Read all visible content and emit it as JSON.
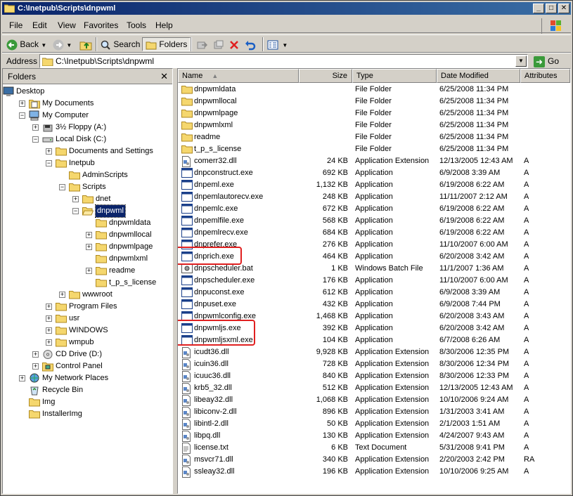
{
  "window": {
    "title": "C:\\Inetpub\\Scripts\\dnpwml"
  },
  "menu": [
    "File",
    "Edit",
    "View",
    "Favorites",
    "Tools",
    "Help"
  ],
  "toolbar": {
    "back": "Back",
    "search": "Search",
    "folders": "Folders"
  },
  "address": {
    "label": "Address",
    "value": "C:\\Inetpub\\Scripts\\dnpwml",
    "go": "Go"
  },
  "folders_pane": {
    "title": "Folders",
    "close": "✕"
  },
  "tree": [
    {
      "label": "Desktop",
      "level": 0,
      "exp": "",
      "icon": "desktop"
    },
    {
      "label": "My Documents",
      "level": 1,
      "exp": "+",
      "icon": "mydocs"
    },
    {
      "label": "My Computer",
      "level": 1,
      "exp": "-",
      "icon": "computer"
    },
    {
      "label": "3½ Floppy (A:)",
      "level": 2,
      "exp": "+",
      "icon": "floppy"
    },
    {
      "label": "Local Disk (C:)",
      "level": 2,
      "exp": "-",
      "icon": "disk"
    },
    {
      "label": "Documents and Settings",
      "level": 3,
      "exp": "+",
      "icon": "folder"
    },
    {
      "label": "Inetpub",
      "level": 3,
      "exp": "-",
      "icon": "folder"
    },
    {
      "label": "AdminScripts",
      "level": 4,
      "exp": "",
      "icon": "folder"
    },
    {
      "label": "Scripts",
      "level": 4,
      "exp": "-",
      "icon": "folder"
    },
    {
      "label": "dnet",
      "level": 5,
      "exp": "+",
      "icon": "folder"
    },
    {
      "label": "dnpwml",
      "level": 5,
      "exp": "-",
      "icon": "folderopen",
      "selected": true
    },
    {
      "label": "dnpwmldata",
      "level": 6,
      "exp": "",
      "icon": "folder"
    },
    {
      "label": "dnpwmllocal",
      "level": 6,
      "exp": "+",
      "icon": "folder"
    },
    {
      "label": "dnpwmlpage",
      "level": 6,
      "exp": "+",
      "icon": "folder"
    },
    {
      "label": "dnpwmlxml",
      "level": 6,
      "exp": "",
      "icon": "folder"
    },
    {
      "label": "readme",
      "level": 6,
      "exp": "+",
      "icon": "folder"
    },
    {
      "label": "t_p_s_license",
      "level": 6,
      "exp": "",
      "icon": "folder"
    },
    {
      "label": "wwwroot",
      "level": 4,
      "exp": "+",
      "icon": "folder"
    },
    {
      "label": "Program Files",
      "level": 3,
      "exp": "+",
      "icon": "folder"
    },
    {
      "label": "usr",
      "level": 3,
      "exp": "+",
      "icon": "folder"
    },
    {
      "label": "WINDOWS",
      "level": 3,
      "exp": "+",
      "icon": "folder"
    },
    {
      "label": "wmpub",
      "level": 3,
      "exp": "+",
      "icon": "folder"
    },
    {
      "label": "CD Drive (D:)",
      "level": 2,
      "exp": "+",
      "icon": "cd"
    },
    {
      "label": "Control Panel",
      "level": 2,
      "exp": "+",
      "icon": "cpanel"
    },
    {
      "label": "My Network Places",
      "level": 1,
      "exp": "+",
      "icon": "network"
    },
    {
      "label": "Recycle Bin",
      "level": 1,
      "exp": "",
      "icon": "recycle"
    },
    {
      "label": "Img",
      "level": 1,
      "exp": "",
      "icon": "folder"
    },
    {
      "label": "InstallerImg",
      "level": 1,
      "exp": "",
      "icon": "folder"
    }
  ],
  "columns": {
    "name": "Name",
    "size": "Size",
    "type": "Type",
    "date": "Date Modified",
    "attr": "Attributes"
  },
  "files": [
    {
      "name": "dnpwmldata",
      "size": "",
      "type": "File Folder",
      "date": "6/25/2008 11:34 PM",
      "attr": "",
      "icon": "folder"
    },
    {
      "name": "dnpwmllocal",
      "size": "",
      "type": "File Folder",
      "date": "6/25/2008 11:34 PM",
      "attr": "",
      "icon": "folder"
    },
    {
      "name": "dnpwmlpage",
      "size": "",
      "type": "File Folder",
      "date": "6/25/2008 11:34 PM",
      "attr": "",
      "icon": "folder"
    },
    {
      "name": "dnpwmlxml",
      "size": "",
      "type": "File Folder",
      "date": "6/25/2008 11:34 PM",
      "attr": "",
      "icon": "folder"
    },
    {
      "name": "readme",
      "size": "",
      "type": "File Folder",
      "date": "6/25/2008 11:34 PM",
      "attr": "",
      "icon": "folder"
    },
    {
      "name": "t_p_s_license",
      "size": "",
      "type": "File Folder",
      "date": "6/25/2008 11:34 PM",
      "attr": "",
      "icon": "folder"
    },
    {
      "name": "comerr32.dll",
      "size": "24 KB",
      "type": "Application Extension",
      "date": "12/13/2005 12:43 AM",
      "attr": "A",
      "icon": "dll"
    },
    {
      "name": "dnpconstruct.exe",
      "size": "692 KB",
      "type": "Application",
      "date": "6/9/2008 3:39 AM",
      "attr": "A",
      "icon": "exe"
    },
    {
      "name": "dnpeml.exe",
      "size": "1,132 KB",
      "type": "Application",
      "date": "6/19/2008 6:22 AM",
      "attr": "A",
      "icon": "exe"
    },
    {
      "name": "dnpemlautorecv.exe",
      "size": "248 KB",
      "type": "Application",
      "date": "11/11/2007 2:12 AM",
      "attr": "A",
      "icon": "exe"
    },
    {
      "name": "dnpemlc.exe",
      "size": "672 KB",
      "type": "Application",
      "date": "6/19/2008 6:22 AM",
      "attr": "A",
      "icon": "exe"
    },
    {
      "name": "dnpemlfile.exe",
      "size": "568 KB",
      "type": "Application",
      "date": "6/19/2008 6:22 AM",
      "attr": "A",
      "icon": "exe"
    },
    {
      "name": "dnpemlrecv.exe",
      "size": "684 KB",
      "type": "Application",
      "date": "6/19/2008 6:22 AM",
      "attr": "A",
      "icon": "exe"
    },
    {
      "name": "dnprefer.exe",
      "size": "276 KB",
      "type": "Application",
      "date": "11/10/2007 6:00 AM",
      "attr": "A",
      "icon": "exe"
    },
    {
      "name": "dnprich.exe",
      "size": "464 KB",
      "type": "Application",
      "date": "6/20/2008 3:42 AM",
      "attr": "A",
      "icon": "exe"
    },
    {
      "name": "dnpscheduler.bat",
      "size": "1 KB",
      "type": "Windows Batch File",
      "date": "11/1/2007 1:36 AM",
      "attr": "A",
      "icon": "bat"
    },
    {
      "name": "dnpscheduler.exe",
      "size": "176 KB",
      "type": "Application",
      "date": "11/10/2007 6:00 AM",
      "attr": "A",
      "icon": "exe"
    },
    {
      "name": "dnpuconst.exe",
      "size": "612 KB",
      "type": "Application",
      "date": "6/9/2008 3:39 AM",
      "attr": "A",
      "icon": "exe"
    },
    {
      "name": "dnpuset.exe",
      "size": "432 KB",
      "type": "Application",
      "date": "6/9/2008 7:44 PM",
      "attr": "A",
      "icon": "exe"
    },
    {
      "name": "dnpwmlconfig.exe",
      "size": "1,468 KB",
      "type": "Application",
      "date": "6/20/2008 3:43 AM",
      "attr": "A",
      "icon": "exe"
    },
    {
      "name": "dnpwmljs.exe",
      "size": "392 KB",
      "type": "Application",
      "date": "6/20/2008 3:42 AM",
      "attr": "A",
      "icon": "exe"
    },
    {
      "name": "dnpwmljsxml.exe",
      "size": "104 KB",
      "type": "Application",
      "date": "6/7/2008 6:26 AM",
      "attr": "A",
      "icon": "exe"
    },
    {
      "name": "icudt36.dll",
      "size": "9,928 KB",
      "type": "Application Extension",
      "date": "8/30/2006 12:35 PM",
      "attr": "A",
      "icon": "dll"
    },
    {
      "name": "icuin36.dll",
      "size": "728 KB",
      "type": "Application Extension",
      "date": "8/30/2006 12:34 PM",
      "attr": "A",
      "icon": "dll"
    },
    {
      "name": "icuuc36.dll",
      "size": "840 KB",
      "type": "Application Extension",
      "date": "8/30/2006 12:33 PM",
      "attr": "A",
      "icon": "dll"
    },
    {
      "name": "krb5_32.dll",
      "size": "512 KB",
      "type": "Application Extension",
      "date": "12/13/2005 12:43 AM",
      "attr": "A",
      "icon": "dll"
    },
    {
      "name": "libeay32.dll",
      "size": "1,068 KB",
      "type": "Application Extension",
      "date": "10/10/2006 9:24 AM",
      "attr": "A",
      "icon": "dll"
    },
    {
      "name": "libiconv-2.dll",
      "size": "896 KB",
      "type": "Application Extension",
      "date": "1/31/2003 3:41 AM",
      "attr": "A",
      "icon": "dll"
    },
    {
      "name": "libintl-2.dll",
      "size": "50 KB",
      "type": "Application Extension",
      "date": "2/1/2003 1:51 AM",
      "attr": "A",
      "icon": "dll"
    },
    {
      "name": "libpq.dll",
      "size": "130 KB",
      "type": "Application Extension",
      "date": "4/24/2007 9:43 AM",
      "attr": "A",
      "icon": "dll"
    },
    {
      "name": "license.txt",
      "size": "6 KB",
      "type": "Text Document",
      "date": "5/31/2008 9:41 PM",
      "attr": "A",
      "icon": "txt"
    },
    {
      "name": "msvcr71.dll",
      "size": "340 KB",
      "type": "Application Extension",
      "date": "2/20/2003 2:42 PM",
      "attr": "RA",
      "icon": "dll"
    },
    {
      "name": "ssleay32.dll",
      "size": "196 KB",
      "type": "Application Extension",
      "date": "10/10/2006 9:25 AM",
      "attr": "A",
      "icon": "dll"
    }
  ],
  "highlight_color": "#e02020",
  "selection_color": "#0a246a"
}
